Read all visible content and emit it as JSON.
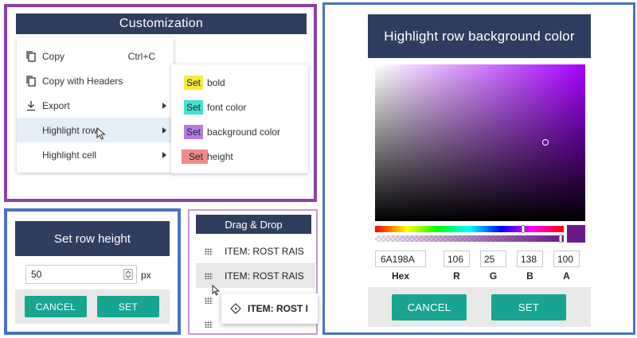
{
  "customization": {
    "title": "Customization",
    "menu": [
      {
        "label": "Copy",
        "shortcut": "Ctrl+C",
        "icon": "copy-icon"
      },
      {
        "label": "Copy with Headers",
        "shortcut": "",
        "icon": "copy-icon"
      },
      {
        "label": "Export",
        "shortcut": "",
        "icon": "download-icon",
        "submenu": true
      },
      {
        "label": "Highlight row",
        "shortcut": "",
        "submenu": true,
        "active": true
      },
      {
        "label": "Highlight cell",
        "shortcut": "",
        "submenu": true
      }
    ],
    "submenu": [
      {
        "chip": "Set",
        "label": "bold",
        "chip_color": "#f7ea3c"
      },
      {
        "chip": "Set",
        "label": "font color",
        "chip_color": "#43e0d0"
      },
      {
        "chip": "Set",
        "label": "background color",
        "chip_color": "#b47ce6"
      },
      {
        "chip": "Set",
        "label": "height",
        "chip_color": "#f08a8a"
      }
    ]
  },
  "row_height": {
    "title": "Set row height",
    "value": "50",
    "unit": "px",
    "cancel_label": "CANCEL",
    "set_label": "SET"
  },
  "drag_drop": {
    "title": "Drag & Drop",
    "items": [
      "ITEM: ROST RAIS",
      "ITEM: ROST RAIS"
    ],
    "dragging_item": "ITEM: ROST I"
  },
  "color_picker": {
    "title": "Highlight row background color",
    "hex": "6A198A",
    "r": "106",
    "g": "25",
    "b": "138",
    "a": "100",
    "labels": {
      "hex": "Hex",
      "r": "R",
      "g": "G",
      "b": "B",
      "a": "A"
    },
    "cancel_label": "CANCEL",
    "set_label": "SET",
    "selected_color": "#6a198a",
    "hue_color": "#a400ff"
  }
}
